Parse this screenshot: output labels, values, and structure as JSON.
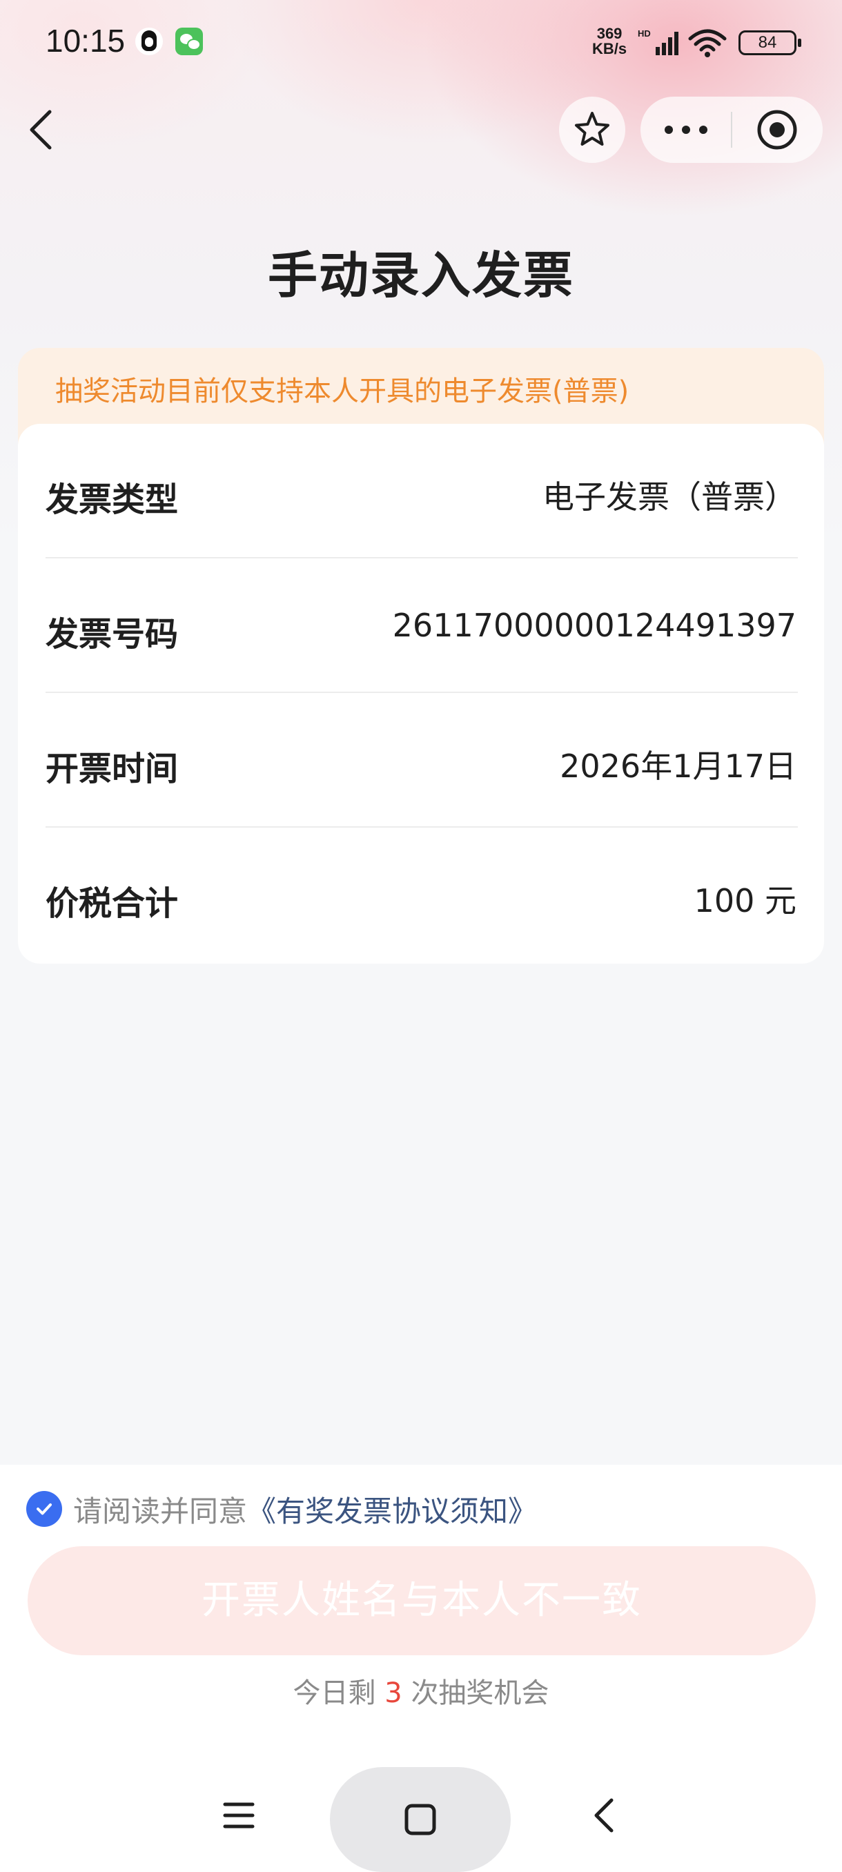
{
  "status_bar": {
    "time": "10:15",
    "net_speed_value": "369",
    "net_speed_unit": "KB/s",
    "network_badge": "HD",
    "battery": "84",
    "icons": [
      "qq-icon",
      "wechat-icon",
      "signal-icon",
      "wifi-icon",
      "battery-icon"
    ]
  },
  "nav": {
    "icons": [
      "back-icon",
      "star-icon",
      "more-icon",
      "close-target-icon"
    ]
  },
  "page": {
    "title": "手动录入发票"
  },
  "notice": {
    "text": "抽奖活动目前仅支持本人开具的电子发票(普票)"
  },
  "invoice": {
    "rows": [
      {
        "label": "发票类型",
        "value": "电子发票（普票）"
      },
      {
        "label": "发票号码",
        "value": "26117000000124491397"
      },
      {
        "label": "开票时间",
        "value": "2026年1月17日"
      },
      {
        "label": "价税合计",
        "value": "100 元"
      }
    ]
  },
  "agreement": {
    "checked": true,
    "prefix": "请阅读并同意",
    "link": "《有奖发票协议须知》"
  },
  "submit": {
    "label": "开票人姓名与本人不一致",
    "disabled": true
  },
  "chances": {
    "prefix": "今日剩",
    "count": "3",
    "suffix": "次抽奖机会"
  },
  "system_nav": {
    "icons": [
      "menu-icon",
      "home-icon",
      "back-icon"
    ]
  },
  "colors": {
    "notice_text": "#ee8a2e",
    "notice_bg": "#fdf0e4",
    "check": "#3a6df0",
    "link": "#3b5480",
    "submit_bg": "#fde9e7",
    "count": "#e8473c"
  }
}
